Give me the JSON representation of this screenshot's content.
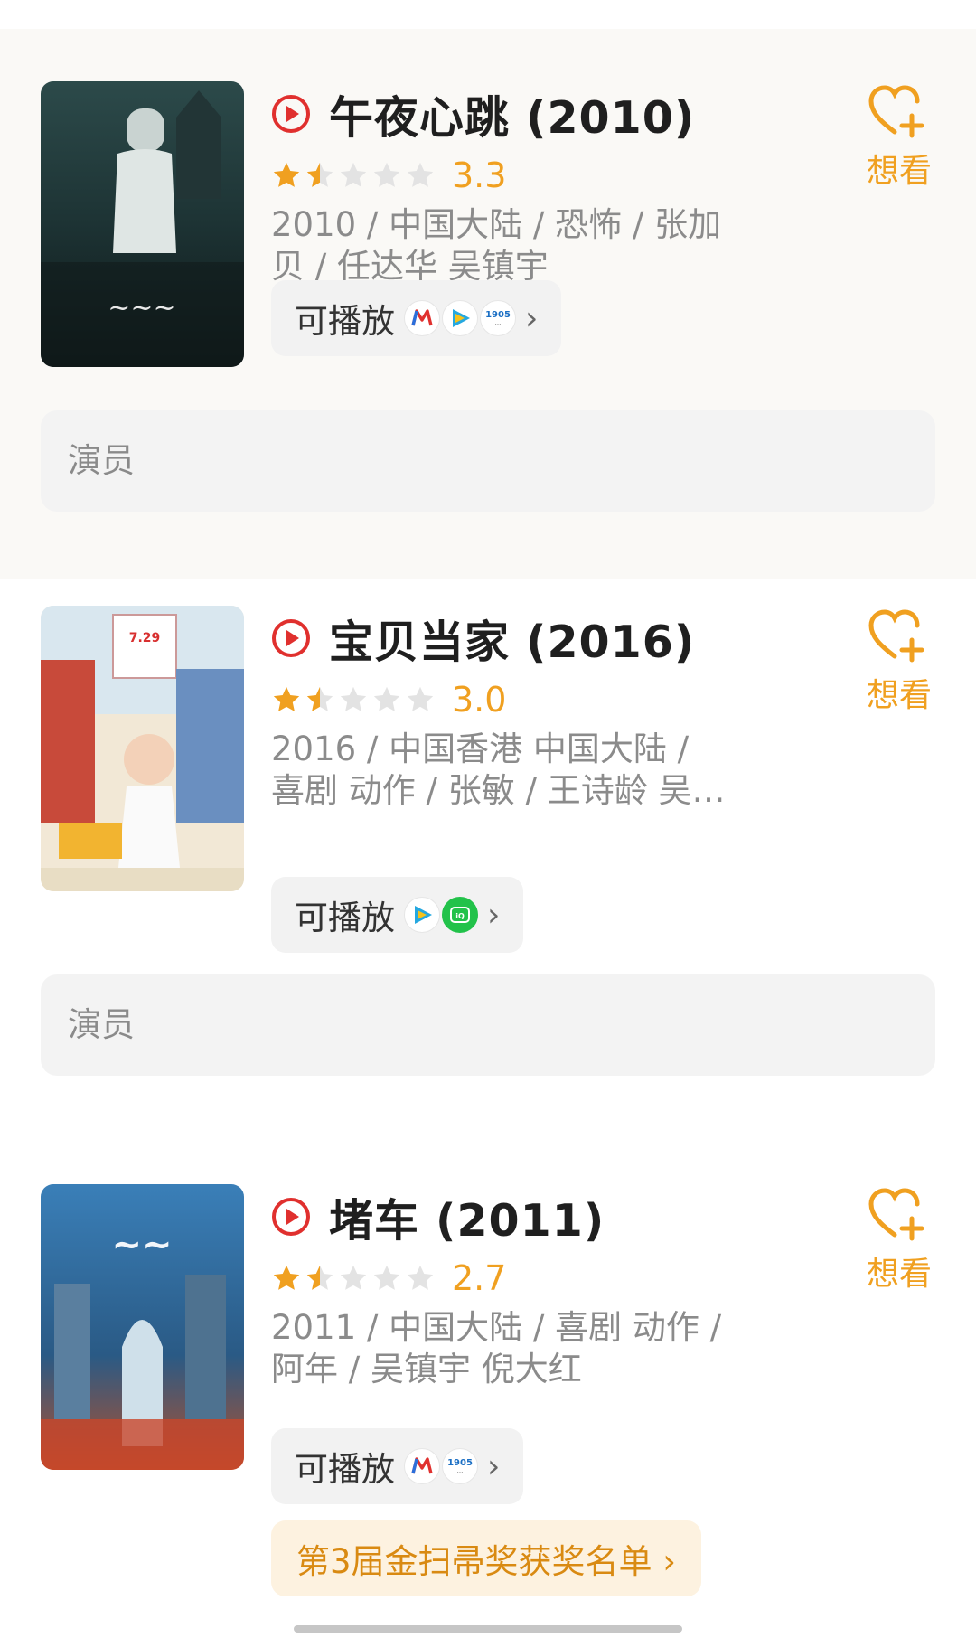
{
  "movies": [
    {
      "title": "午夜心跳 (2010)",
      "score": "3.3",
      "meta_line1": "2010 / 中国大陆 / 恐怖 / 张加",
      "meta_line2": "贝 / 任达华 吴镇宇",
      "play_label": "可播放",
      "platforms": [
        "migu-icon",
        "tencent-video-icon",
        "1905-icon"
      ],
      "want_label": "想看",
      "cast_label": "演员"
    },
    {
      "title": "宝贝当家 (2016)",
      "score": "3.0",
      "meta_line1": "2016 / 中国香港 中国大陆 /",
      "meta_line2": "喜剧 动作 / 张敏 / 王诗龄 吴…",
      "play_label": "可播放",
      "platforms": [
        "tencent-video-icon",
        "iqiyi-icon"
      ],
      "want_label": "想看",
      "cast_label": "演员"
    },
    {
      "title": "堵车 (2011)",
      "score": "2.7",
      "meta_line1": "2011 / 中国大陆 / 喜剧 动作 /",
      "meta_line2": "阿年 / 吴镇宇 倪大红",
      "play_label": "可播放",
      "platforms": [
        "migu-icon",
        "1905-icon"
      ],
      "want_label": "想看",
      "award_label": "第3届金扫帚奖获奖名单 ›"
    }
  ],
  "colors": {
    "accent": "#f0a020",
    "play_red": "#e0302e"
  }
}
